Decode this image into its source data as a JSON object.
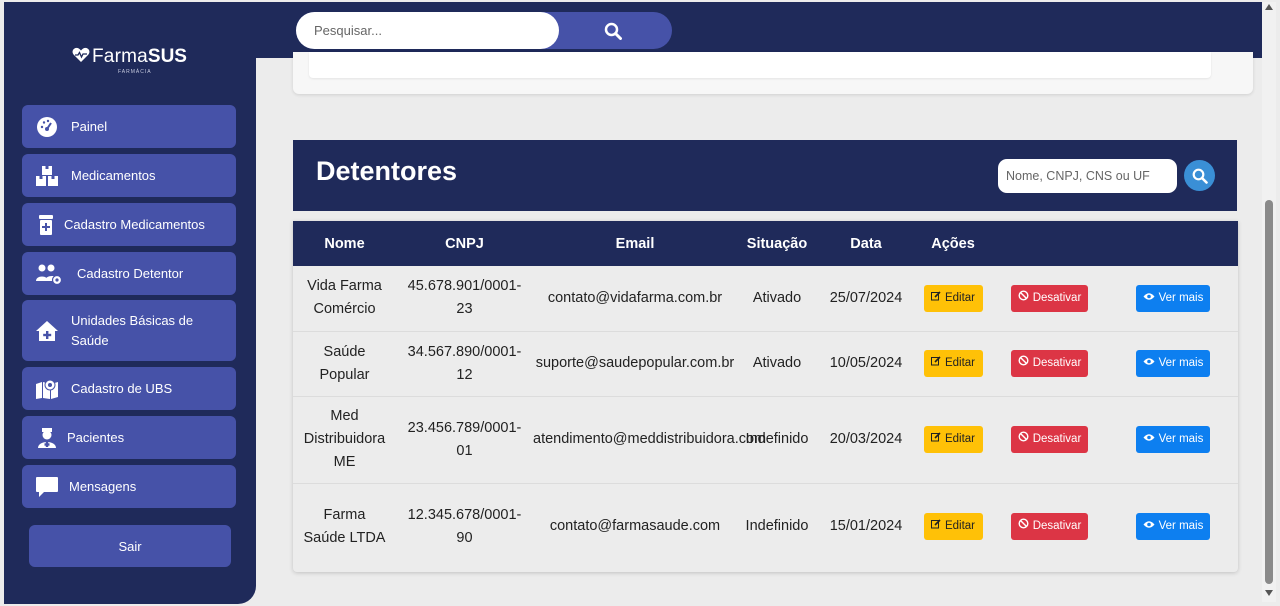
{
  "logo": {
    "brand_light": "Farma",
    "brand_bold": "SUS",
    "tagline": "FARMÁCIA"
  },
  "sidebar": {
    "items": [
      {
        "label": "Painel",
        "icon": "dashboard-icon"
      },
      {
        "label": "Medicamentos",
        "icon": "boxes-icon"
      },
      {
        "label": "Cadastro Medicamentos",
        "icon": "medicine-add-icon"
      },
      {
        "label": "Cadastro Detentor",
        "icon": "users-gear-icon"
      },
      {
        "label": "Unidades Básicas de Saúde",
        "icon": "house-medical-icon"
      },
      {
        "label": "Cadastro de UBS",
        "icon": "map-location-icon"
      },
      {
        "label": "Pacientes",
        "icon": "user-doctor-icon"
      },
      {
        "label": "Mensagens",
        "icon": "message-icon"
      }
    ],
    "logout_label": "Sair"
  },
  "search": {
    "placeholder": "Pesquisar..."
  },
  "detentores": {
    "title": "Detentores",
    "search_placeholder": "Nome, CNPJ, CNS ou UF"
  },
  "table": {
    "headers": [
      "Nome",
      "CNPJ",
      "Email",
      "Situação",
      "Data",
      "Ações"
    ],
    "rows": [
      {
        "nome": "Vida Farma Comércio",
        "cnpj": "45.678.901/0001-23",
        "email": "contato@vidafarma.com.br",
        "situacao": "Ativado",
        "data": "25/07/2024"
      },
      {
        "nome": "Saúde Popular",
        "cnpj": "34.567.890/0001-12",
        "email": "suporte@saudepopular.com.br",
        "situacao": "Ativado",
        "data": "10/05/2024"
      },
      {
        "nome": "Med Distribuidora ME",
        "cnpj": "23.456.789/0001-01",
        "email": "atendimento@meddistribuidora.com",
        "situacao": "Indefinido",
        "data": "20/03/2024"
      },
      {
        "nome": "Farma Saúde LTDA",
        "cnpj": "12.345.678/0001-90",
        "email": "contato@farmasaude.com",
        "situacao": "Indefinido",
        "data": "15/01/2024"
      }
    ],
    "actions": {
      "edit": "Editar",
      "deactivate": "Desativar",
      "more": "Ver mais"
    }
  },
  "colors": {
    "navy": "#1f2a5a",
    "nav_button": "#4652a8",
    "edit": "#ffc107",
    "deactivate": "#dc3545",
    "more": "#0d7ff0",
    "search_accent": "#3a8fd6"
  }
}
